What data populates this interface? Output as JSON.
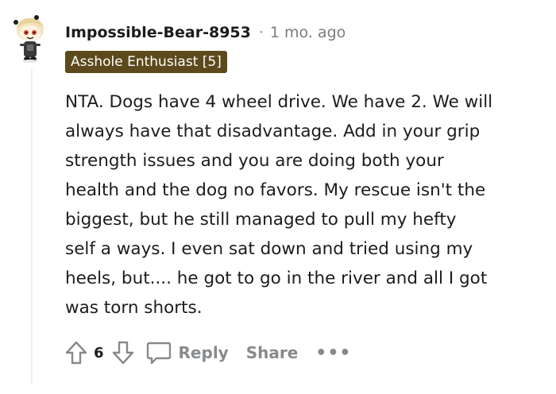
{
  "comment": {
    "username": "Impossible-Bear-8953",
    "separator": "·",
    "timestamp": "1 mo. ago",
    "flair": "Asshole Enthusiast [5]",
    "body_lines": [
      "NTA. Dogs have 4 wheel drive. We have 2. We will",
      "always have that disadvantage. Add in your grip",
      "strength issues and you are doing both your",
      "health and the dog no favors. My rescue isn't the",
      "biggest, but he still managed to pull my hefty",
      "self a ways. I even sat down and tried using my",
      "heels, but.... he got to go in the river and all I got",
      "was torn shorts."
    ]
  },
  "actions": {
    "upvote_icon": "upvote-arrow-icon",
    "score": "6",
    "downvote_icon": "downvote-arrow-icon",
    "reply_icon": "speech-bubble-icon",
    "reply_label": "Reply",
    "share_label": "Share",
    "more_label": "•••"
  },
  "colors": {
    "flair_background": "#5c4a1c",
    "muted_text": "#878a8c",
    "thread_line": "#edeff1"
  }
}
